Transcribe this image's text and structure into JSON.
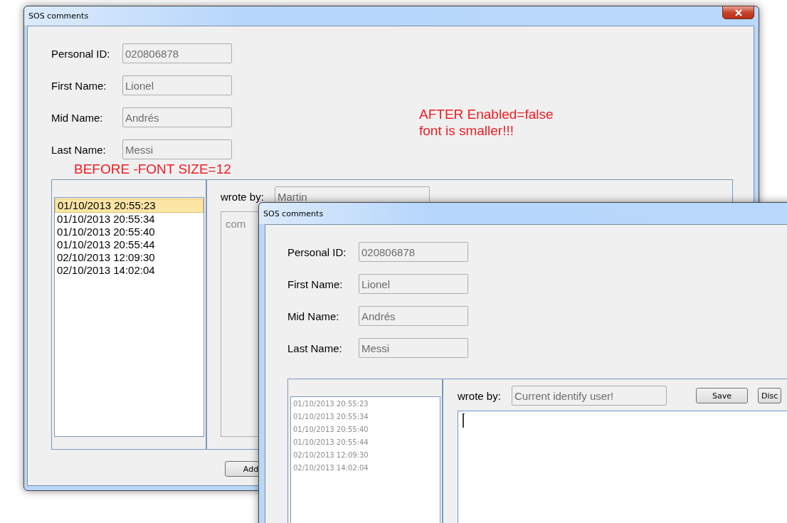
{
  "windows": [
    {
      "title": "SOS comments",
      "fields": [
        {
          "label": "Personal ID:",
          "value": "020806878"
        },
        {
          "label": "First Name:",
          "value": "Lionel"
        },
        {
          "label": "Mid Name:",
          "value": "Andrés"
        },
        {
          "label": "Last Name:",
          "value": "Messi"
        }
      ],
      "side_note": [
        "AFTER Enabled=false",
        "font is smaller!!!"
      ],
      "note": "BEFORE -FONT SIZE=12",
      "history": {
        "disabled": false,
        "items": [
          {
            "text": "01/10/2013 20:55:23",
            "selected": true
          },
          {
            "text": "01/10/2013 20:55:34",
            "selected": false
          },
          {
            "text": "01/10/2013 20:55:40",
            "selected": false
          },
          {
            "text": "01/10/2013 20:55:44",
            "selected": false
          },
          {
            "text": "02/10/2013 12:09:30",
            "selected": false
          },
          {
            "text": "02/10/2013 14:02:04",
            "selected": false
          }
        ]
      },
      "wrote_by": {
        "label": "wrote by:",
        "value": "Martin"
      },
      "comment": {
        "placeholder": "com",
        "caret": false
      },
      "buttons": [
        "Add"
      ]
    },
    {
      "title": "SOS comments",
      "fields": [
        {
          "label": "Personal ID:",
          "value": "020806878"
        },
        {
          "label": "First Name:",
          "value": "Lionel"
        },
        {
          "label": "Mid Name:",
          "value": "Andrés"
        },
        {
          "label": "Last Name:",
          "value": "Messi"
        }
      ],
      "history": {
        "disabled": true,
        "items": [
          {
            "text": "01/10/2013 20:55:23",
            "selected": false
          },
          {
            "text": "01/10/2013 20:55:34",
            "selected": false
          },
          {
            "text": "01/10/2013 20:55:40",
            "selected": false
          },
          {
            "text": "01/10/2013 20:55:44",
            "selected": false
          },
          {
            "text": "02/10/2013 12:09:30",
            "selected": false
          },
          {
            "text": "02/10/2013 14:02:04",
            "selected": false
          }
        ]
      },
      "wrote_by": {
        "label": "wrote by:",
        "value": "Current identify user!"
      },
      "comment": {
        "caret": true
      },
      "buttons": [
        "Save",
        "Disc"
      ]
    }
  ]
}
